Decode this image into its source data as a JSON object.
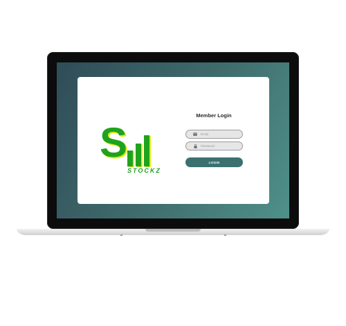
{
  "brand": {
    "name": "STOCKZ",
    "mark_letter": "S",
    "colors": {
      "green": "#1fa31f",
      "yellow": "#e3ea15"
    }
  },
  "login": {
    "title": "Member Login",
    "email": {
      "placeholder": "Email",
      "value": "",
      "icon": "envelope-icon"
    },
    "password": {
      "placeholder": "Password",
      "value": "",
      "icon": "lock-icon"
    },
    "button_label": "LOGIN"
  },
  "theme": {
    "screen_gradient": [
      "#2f4c58",
      "#4f918a"
    ],
    "button_color": "#3c7070"
  }
}
